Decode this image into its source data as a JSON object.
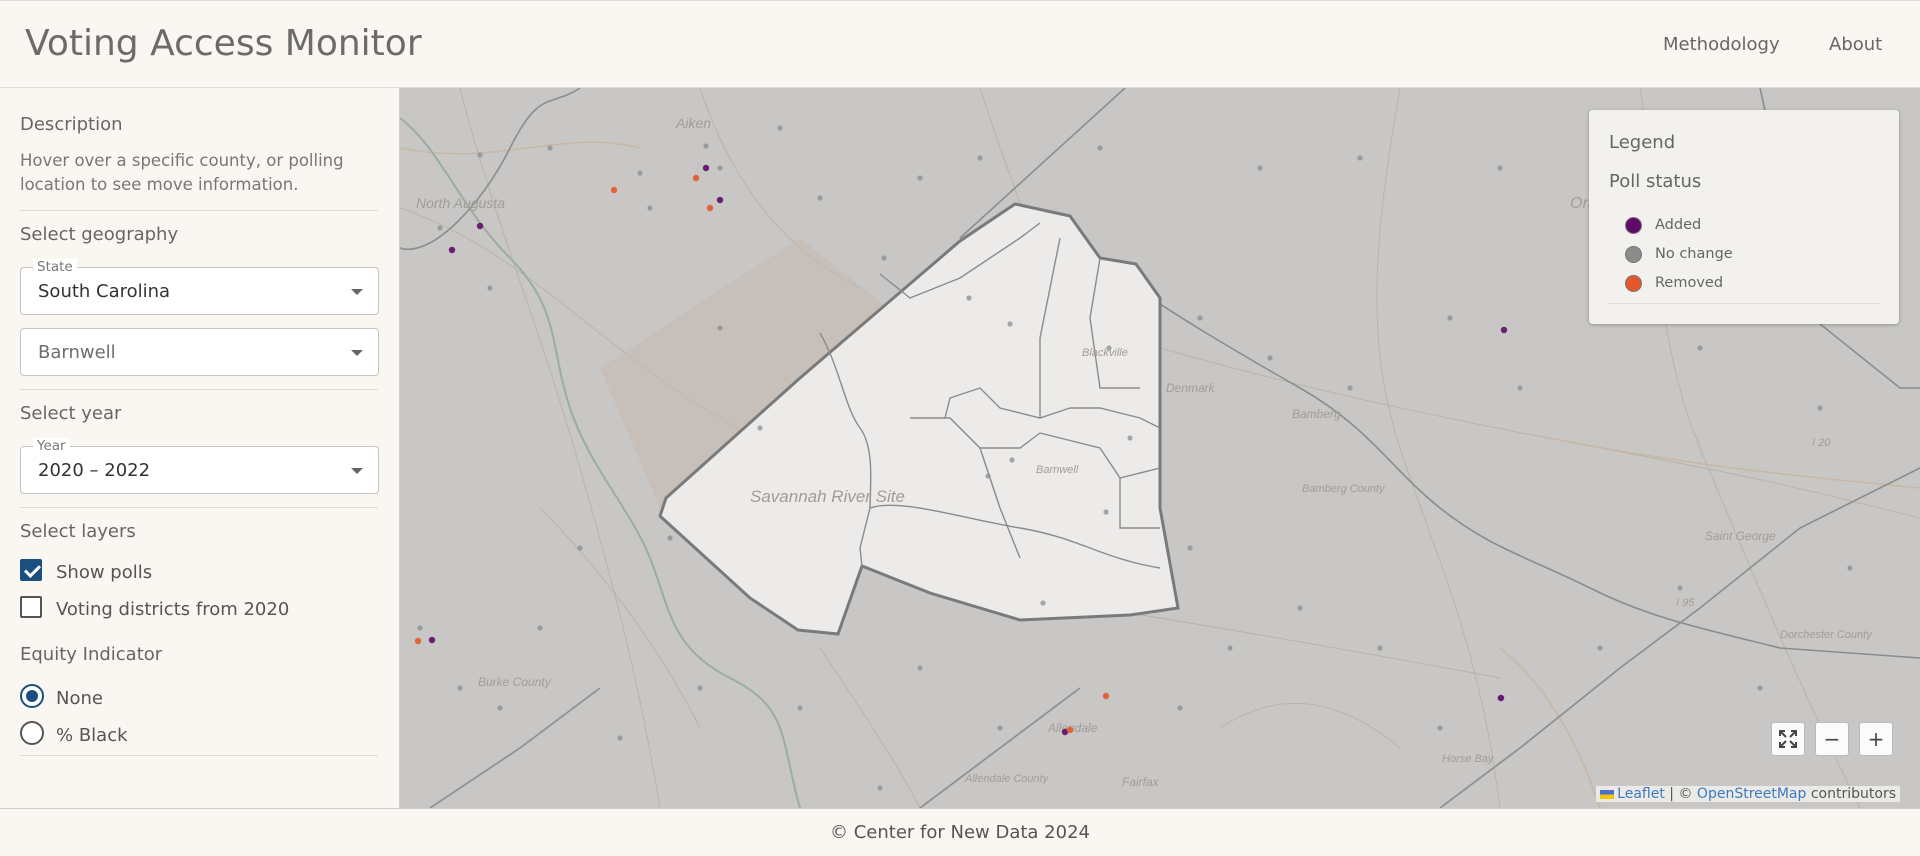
{
  "header": {
    "title": "Voting Access Monitor",
    "nav": {
      "methodology": "Methodology",
      "about": "About"
    }
  },
  "sidebar": {
    "description": {
      "title": "Description",
      "text": "Hover over a specific county, or polling location to see move information."
    },
    "geography": {
      "title": "Select geography",
      "state_label": "State",
      "state_value": "South Carolina",
      "county_value": "Barnwell"
    },
    "year": {
      "title": "Select year",
      "label": "Year",
      "value": "2020 – 2022"
    },
    "layers": {
      "title": "Select layers",
      "show_polls": {
        "label": "Show polls",
        "checked": true
      },
      "voting_districts": {
        "label": "Voting districts from 2020",
        "checked": false
      }
    },
    "equity": {
      "title": "Equity Indicator",
      "options": [
        {
          "label": "None",
          "selected": true
        },
        {
          "label": "% Black",
          "selected": false
        }
      ]
    }
  },
  "map": {
    "place_labels": [
      "Savannah River Site",
      "Orangeburg",
      "Denmark",
      "Bamberg",
      "Bamberg County",
      "Allendale",
      "Fairfax",
      "Burke County",
      "Barnwell",
      "Blackville",
      "Saint George",
      "Dorchester County",
      "Aiken",
      "North Augusta",
      "Horse Bay",
      "Allendale County",
      "I 20",
      "I 95"
    ],
    "legend": {
      "title": "Legend",
      "subtitle": "Poll status",
      "items": [
        {
          "label": "Added",
          "color": "#5e0a6b"
        },
        {
          "label": "No change",
          "color": "#8c8c8c"
        },
        {
          "label": "Removed",
          "color": "#e5582a"
        }
      ]
    },
    "controls": {
      "fullscreen_icon": "fullscreen-icon",
      "zoom_out": "−",
      "zoom_in": "+"
    },
    "attribution": {
      "leaflet": "Leaflet",
      "separator": " | © ",
      "osm": "OpenStreetMap",
      "suffix": " contributors"
    }
  },
  "footer": {
    "text": "© Center for New Data 2024"
  }
}
